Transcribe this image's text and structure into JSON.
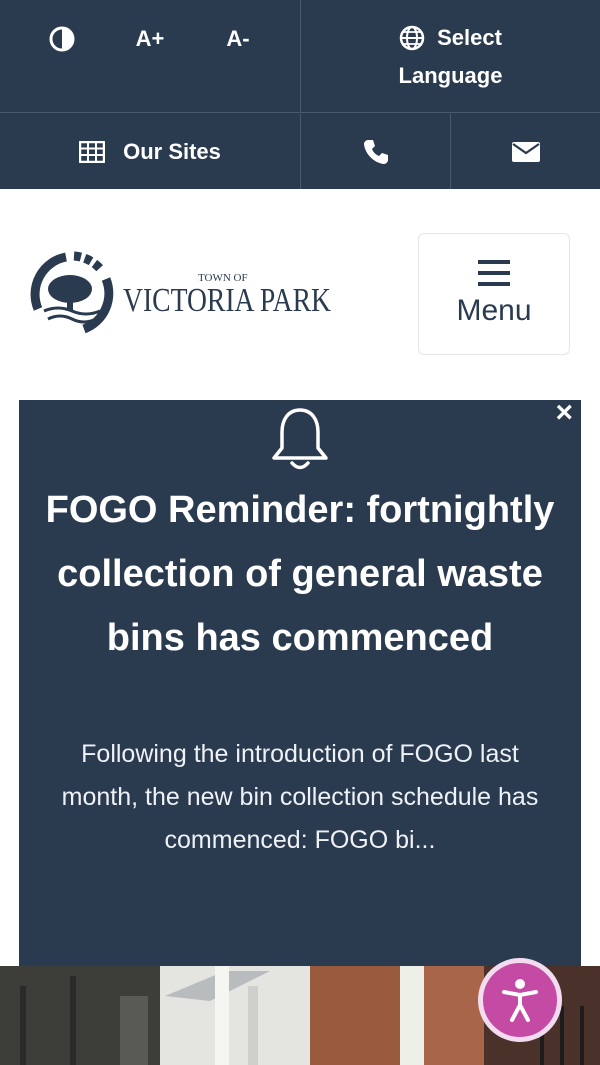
{
  "topbar": {
    "contrast_icon": "contrast-icon",
    "font_increase_label": "A+",
    "font_decrease_label": "A-",
    "language_line1": "Select",
    "language_line2": "Language",
    "language_icon": "globe-icon",
    "our_sites_label": "Our Sites",
    "our_sites_icon": "grid-icon",
    "phone_icon": "phone-icon",
    "email_icon": "envelope-icon"
  },
  "header": {
    "logo_small": "TOWN OF",
    "logo_main": "VICTORIA PARK",
    "menu_label": "Menu"
  },
  "alert": {
    "title": "FOGO Reminder: fortnightly collection of general waste bins has commenced",
    "body": "Following the introduction of FOGO last month, the new bin collection schedule has commenced: FOGO bi...",
    "close_label": "×"
  },
  "colors": {
    "navy": "#2a3a4f",
    "accessibility": "#c44aa3"
  }
}
